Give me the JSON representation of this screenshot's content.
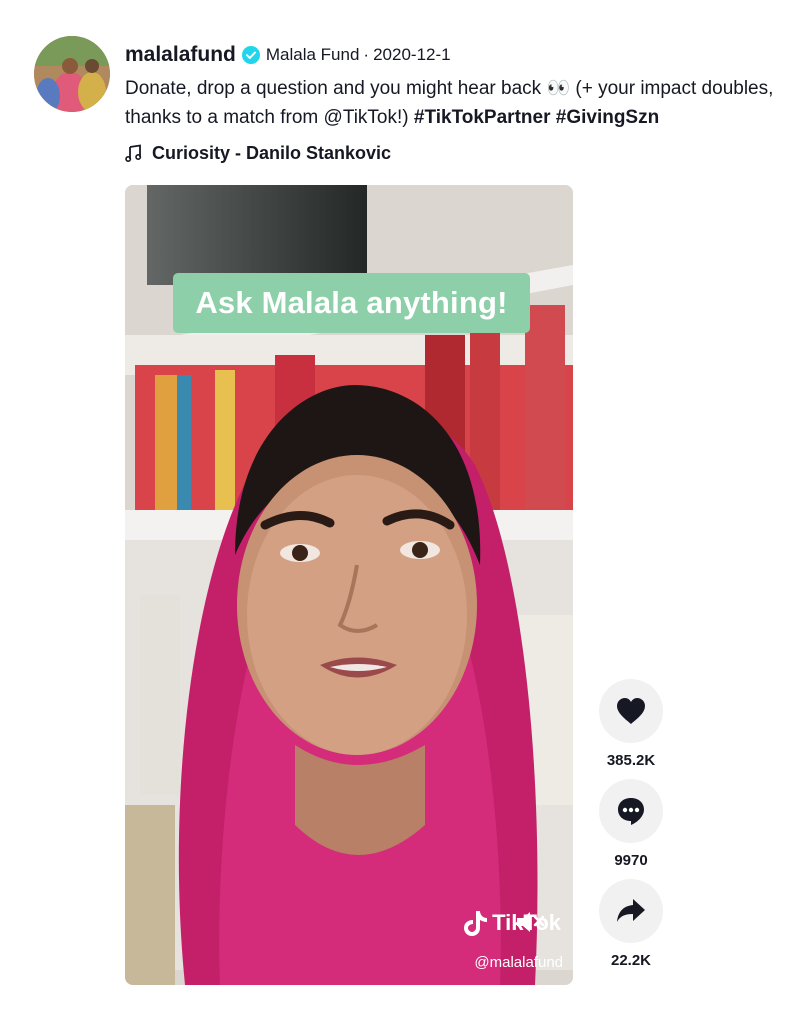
{
  "post": {
    "username": "malalafund",
    "nickname": "Malala Fund",
    "separator": "·",
    "date": "2020-12-1",
    "description_text": "Donate, drop a question and you might hear back 👀 (+ your impact doubles, thanks to a match from @TikTok!) ",
    "hashtags": [
      "#TikTokPartner",
      "#GivingSzn"
    ],
    "music": "Curiosity - Danilo Stankovic"
  },
  "video": {
    "overlay_text": "Ask Malala anything!",
    "watermark_brand": "TikTok",
    "watermark_handle": "@malalafund"
  },
  "actions": {
    "likes": "385.2K",
    "comments": "9970",
    "shares": "22.2K"
  },
  "colors": {
    "verified": "#20d5ec",
    "overlay_label": "#8ccfa8",
    "action_bg": "#f1f1f2",
    "text": "#161823"
  },
  "icons": {
    "like": "heart-icon",
    "comment": "comment-icon",
    "share": "share-icon",
    "music": "music-note-icon",
    "verified": "verified-badge-icon",
    "mute": "mute-icon"
  }
}
